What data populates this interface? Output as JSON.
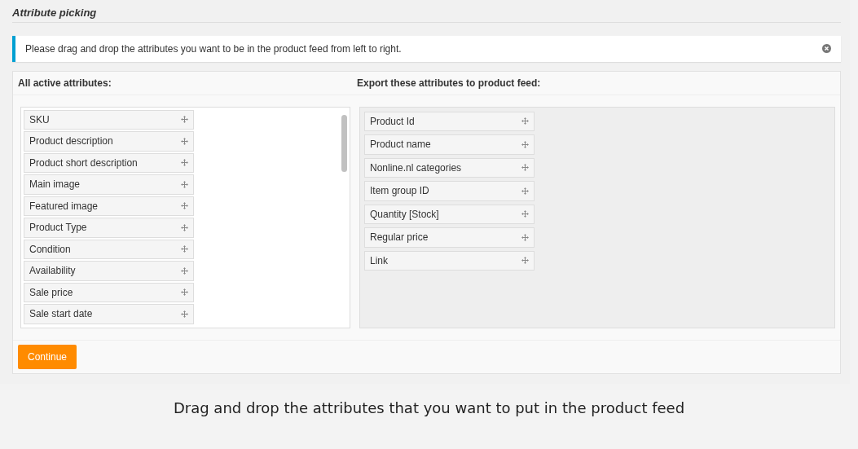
{
  "section_title": "Attribute picking",
  "notice": {
    "text": "Please drag and drop the attributes you want to be in the product feed from left to right."
  },
  "available": {
    "heading": "All active attributes:",
    "items": [
      "SKU",
      "Product description",
      "Product short description",
      "Main image",
      "Featured image",
      "Product Type",
      "Condition",
      "Availability",
      "Sale price",
      "Sale start date"
    ]
  },
  "export": {
    "heading": "Export these attributes to product feed:",
    "items": [
      "Product Id",
      "Product name",
      "Nonline.nl categories",
      "Item group ID",
      "Quantity [Stock]",
      "Regular price",
      "Link"
    ]
  },
  "buttons": [
    "Continue"
  ],
  "caption": "Drag and drop the attributes that you want to put in the product feed"
}
